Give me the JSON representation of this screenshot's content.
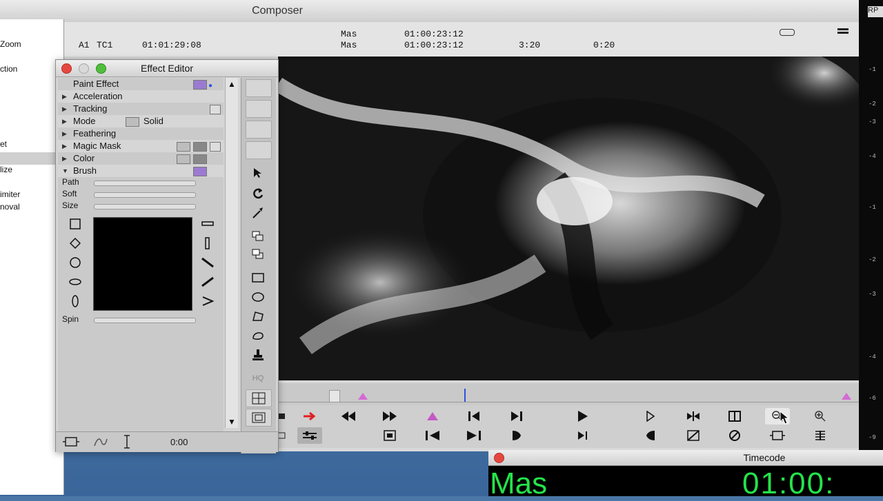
{
  "composer": {
    "title": "Composer",
    "info": {
      "track": "A1",
      "tc_label": "TC1",
      "tc_value": "01:01:29:08",
      "mas_label_1": "Mas",
      "mas_value_1": "01:00:23:12",
      "mas_label_2": "Mas",
      "mas_value_2": "01:00:23:12",
      "duration_1": "3:20",
      "duration_2": "0:20"
    }
  },
  "left_window": {
    "items": [
      "Zoom",
      "ction",
      "et",
      "lize",
      "imiter",
      "noval"
    ]
  },
  "right_strip": {
    "label": "RP",
    "ticks": [
      "-1",
      "-2",
      "-3",
      "-4",
      "-1",
      "-2",
      "-3",
      "-4",
      "-6",
      "-9"
    ]
  },
  "effect_editor": {
    "title": "Effect Editor",
    "rows": [
      {
        "label": "Paint Effect"
      },
      {
        "label": "Acceleration"
      },
      {
        "label": "Tracking"
      },
      {
        "label": "Mode",
        "value": "Solid"
      },
      {
        "label": "Feathering"
      },
      {
        "label": "Magic Mask"
      },
      {
        "label": "Color"
      },
      {
        "label": "Brush"
      }
    ],
    "sliders": {
      "path_label": "Path",
      "soft_label": "Soft",
      "size_label": "Size",
      "spin_label": "Spin"
    },
    "tools": {
      "hq_label": "HQ"
    },
    "footer": {
      "time": "0:00"
    }
  },
  "timecode_window": {
    "title": "Timecode",
    "label": "Mas",
    "value": "01:00:"
  }
}
